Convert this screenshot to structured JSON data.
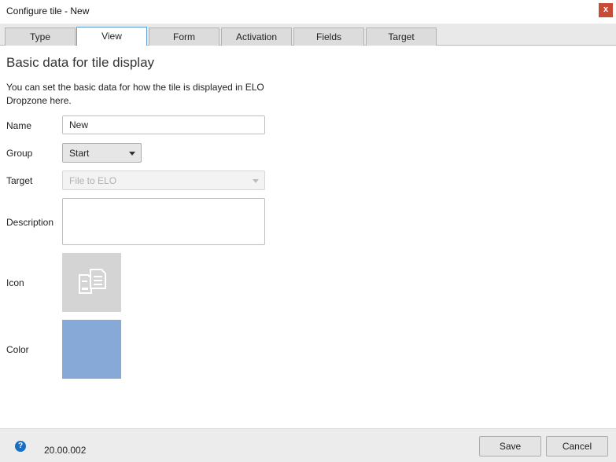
{
  "window": {
    "title": "Configure tile - New",
    "close_label": "x"
  },
  "tabs": [
    {
      "label": "Type"
    },
    {
      "label": "View",
      "active": true
    },
    {
      "label": "Form"
    },
    {
      "label": "Activation"
    },
    {
      "label": "Fields"
    },
    {
      "label": "Target"
    }
  ],
  "main": {
    "heading": "Basic data for tile display",
    "description": "You can set the basic data for how the tile is displayed in ELO Dropzone here."
  },
  "form": {
    "name": {
      "label": "Name",
      "value": "New"
    },
    "group": {
      "label": "Group",
      "selected": "Start"
    },
    "target": {
      "label": "Target",
      "selected": "File to ELO",
      "disabled": true
    },
    "description": {
      "label": "Description",
      "value": ""
    },
    "icon": {
      "label": "Icon",
      "icon_name": "documents-icon",
      "background": "#d4d4d4"
    },
    "color": {
      "label": "Color",
      "value": "#87a9d8"
    }
  },
  "footer": {
    "help_label": "?",
    "version": "20.00.002",
    "save_label": "Save",
    "cancel_label": "Cancel"
  },
  "colors": {
    "close_button": "#c94b35",
    "active_tab_border": "#5b9bd5",
    "help_icon": "#1a6ec1"
  }
}
